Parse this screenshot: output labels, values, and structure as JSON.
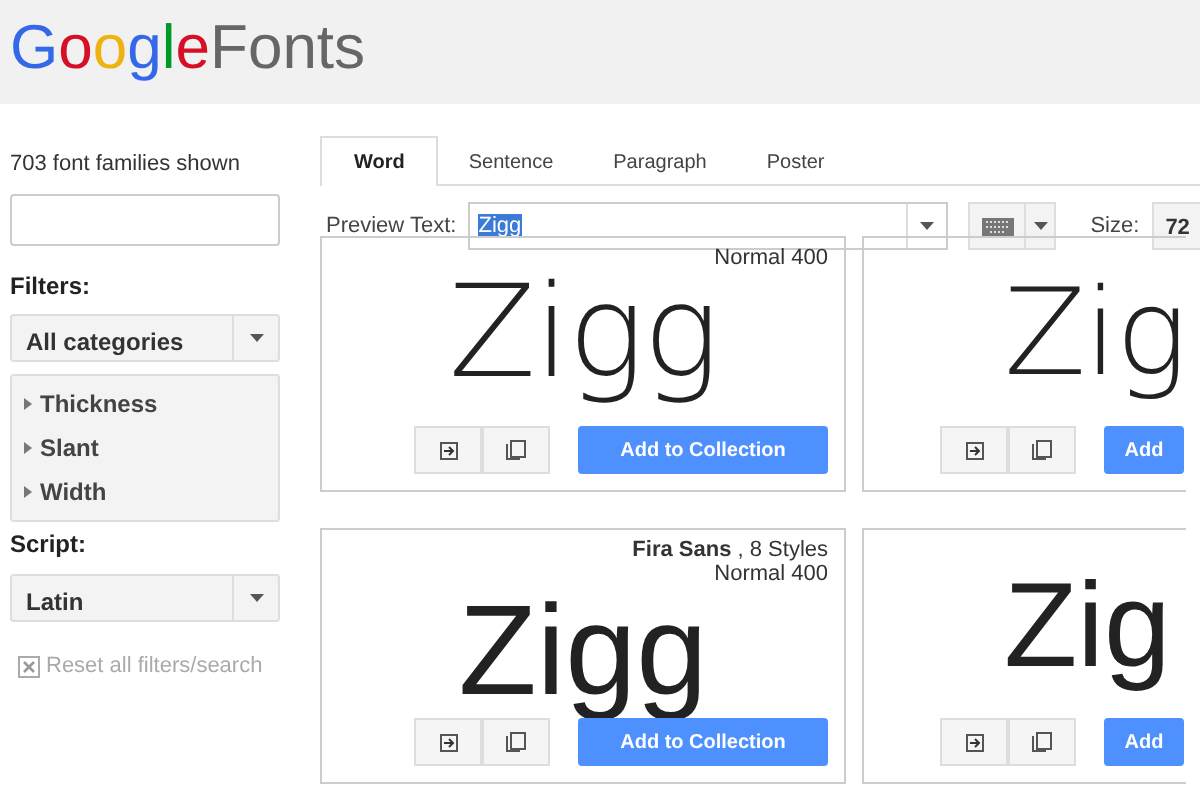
{
  "header": {
    "logo_google": "Google",
    "logo_fonts": "Fonts"
  },
  "sidebar": {
    "count": "703 font families shown",
    "filters_label": "Filters:",
    "category": "All categories",
    "filters": [
      {
        "label": "Thickness",
        "expanded": false
      },
      {
        "label": "Slant",
        "expanded": false
      },
      {
        "label": "Width",
        "expanded": false
      }
    ],
    "script_label": "Script:",
    "script": "Latin",
    "reset": "Reset all filters/search"
  },
  "tabs": [
    {
      "label": "Word",
      "selected": true
    },
    {
      "label": "Sentence",
      "selected": false
    },
    {
      "label": "Paragraph",
      "selected": false
    },
    {
      "label": "Poster",
      "selected": false
    }
  ],
  "toolbar": {
    "preview_label": "Preview Text:",
    "preview_value": "Zigg",
    "size_label": "Size:",
    "size_value": "72"
  },
  "cards": [
    {
      "style": "Normal 400",
      "sample": "Zigg",
      "kind": "geometric",
      "button": "Add to Collection"
    },
    {
      "sample": "Zig",
      "kind": "geometric",
      "button": "Add"
    },
    {
      "title": "**Fira Sans** , 8 Styles",
      "style": "Normal 400",
      "sample": "Zigg",
      "kind": "humanist",
      "button": "Add to Collection"
    },
    {
      "sample": "Zig",
      "kind": "humanist",
      "button": "Add"
    }
  ]
}
